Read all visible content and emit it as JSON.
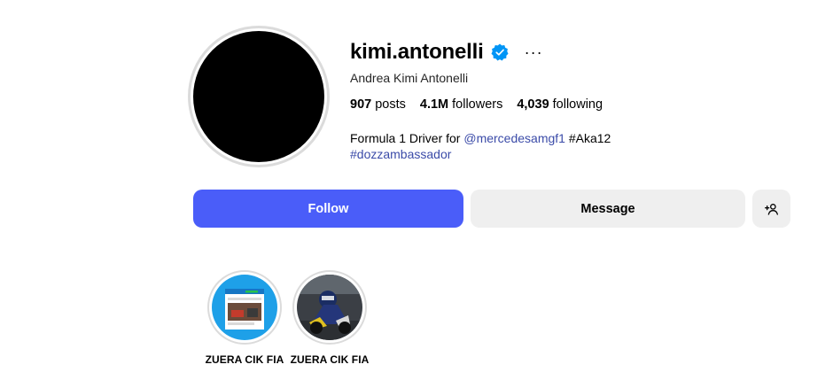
{
  "profile": {
    "username": "kimi.antonelli",
    "full_name": "Andrea Kimi Antonelli",
    "verified": true,
    "more_glyph": "···"
  },
  "stats": {
    "posts_count": "907",
    "posts_label": "posts",
    "followers_count": "4.1M",
    "followers_label": "followers",
    "following_count": "4,039",
    "following_label": "following"
  },
  "bio": {
    "text": "Formula 1 Driver for ",
    "mention": "@mercedesamgf1",
    "hashtag1": "#Aka12",
    "hashtag2": "#dozzambassador"
  },
  "actions": {
    "follow_label": "Follow",
    "message_label": "Message"
  },
  "highlights": [
    {
      "label": "ZUERA CIK FIA"
    },
    {
      "label": "ZUERA CIK FIA"
    }
  ],
  "colors": {
    "follow_bg": "#4a5df9",
    "secondary_bg": "#efefef",
    "link": "#3b4ba8",
    "verified": "#0095f6"
  }
}
